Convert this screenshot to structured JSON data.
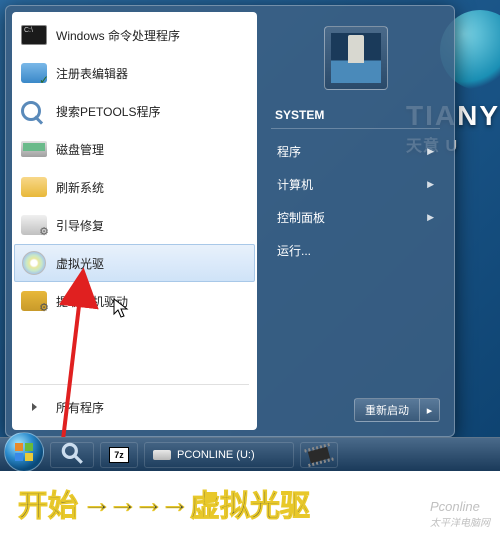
{
  "desktop": {
    "logo_top": "TIANY",
    "logo_sub": "天意 U"
  },
  "start_menu": {
    "left_items": [
      {
        "label": "Windows 命令处理程序",
        "icon": "cmd-icon"
      },
      {
        "label": "注册表编辑器",
        "icon": "regedit-icon"
      },
      {
        "label": "搜索PETOOLS程序",
        "icon": "search-icon"
      },
      {
        "label": "磁盘管理",
        "icon": "disk-mgmt-icon"
      },
      {
        "label": "刷新系统",
        "icon": "refresh-icon"
      },
      {
        "label": "引导修复",
        "icon": "boot-repair-icon"
      },
      {
        "label": "虚拟光驱",
        "icon": "virtual-cd-icon"
      },
      {
        "label": "提取本机驱动",
        "icon": "extract-driver-icon"
      }
    ],
    "all_programs": "所有程序",
    "right": {
      "system_label": "SYSTEM",
      "items": [
        {
          "label": "程序"
        },
        {
          "label": "计算机"
        },
        {
          "label": "控制面板"
        },
        {
          "label": "运行..."
        }
      ],
      "restart": "重新启动"
    }
  },
  "taskbar": {
    "sevenz": "7z",
    "drive_label": "PCONLINE (U:)"
  },
  "caption": {
    "left": "开始",
    "arrows": "→→→→",
    "right": "虚拟光驱",
    "watermark": "Pconline",
    "watermark_sub": "太平洋电脑网"
  }
}
